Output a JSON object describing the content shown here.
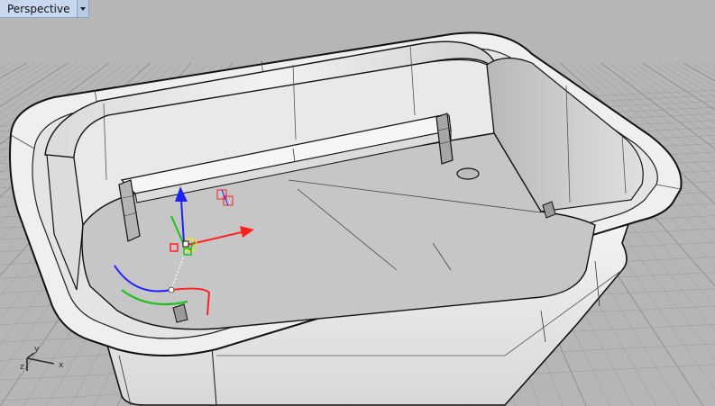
{
  "viewport": {
    "name": "Perspective"
  },
  "colors": {
    "background": "#b6b6b6",
    "grid_line": "#9a9a9a",
    "grid_major": "#8c8c8c",
    "model_surface": "#ececec",
    "model_shadow": "#c9c9c9",
    "model_floor": "#c8c8c8",
    "edge": "#111111",
    "axis_x": "#ff2020",
    "axis_y": "#20c020",
    "axis_z": "#2020ff",
    "tab_background": "#c8d8ee"
  },
  "icons": {
    "dropdown": "chevron-down-icon",
    "gumball": "gumball-widget",
    "world_axes": "world-axes-icon"
  },
  "world_axes": {
    "x_label": "x",
    "y_label": "y",
    "z_label": "z"
  }
}
